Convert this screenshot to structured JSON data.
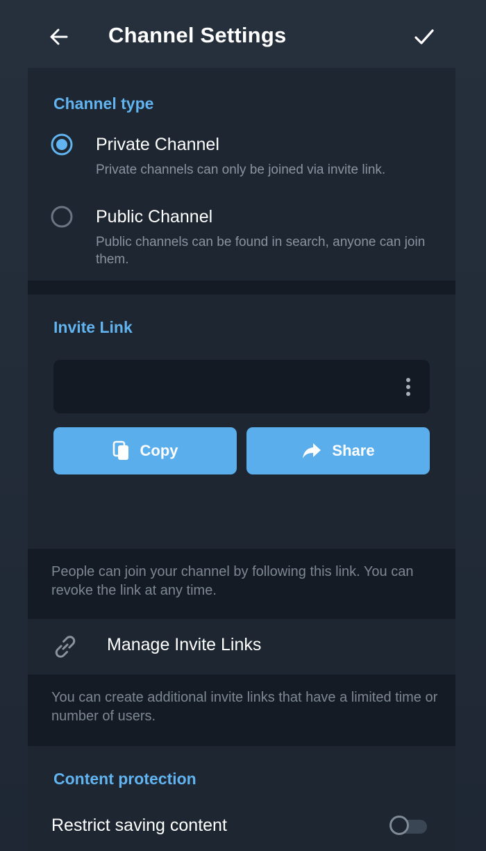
{
  "header": {
    "title": "Channel Settings"
  },
  "channel_type": {
    "section_title": "Channel type",
    "selected": "private",
    "options": [
      {
        "label": "Private Channel",
        "description": "Private channels can only be joined via invite link."
      },
      {
        "label": "Public Channel",
        "description": "Public channels can be found in search, anyone can join them."
      }
    ]
  },
  "invite_link": {
    "section_title": "Invite Link",
    "link_value": "",
    "copy_label": "Copy",
    "share_label": "Share",
    "info": "People can join your channel by following this link. You can revoke the link at any time."
  },
  "manage_links": {
    "label": "Manage Invite Links",
    "info": "You can create additional invite links that have a limited time or number of users."
  },
  "content_protection": {
    "section_title": "Content protection",
    "restrict_label": "Restrict saving content",
    "restrict_enabled": false
  },
  "colors": {
    "accent": "#62b4f0",
    "button": "#5aaeec",
    "background": "#1d2631",
    "secondary_text": "#8a949f"
  },
  "icons": {
    "back": "arrow-left-icon",
    "confirm": "checkmark-icon",
    "more": "vertical-dots-icon",
    "copy": "copy-icon",
    "share": "share-arrow-icon",
    "link": "link-icon"
  }
}
